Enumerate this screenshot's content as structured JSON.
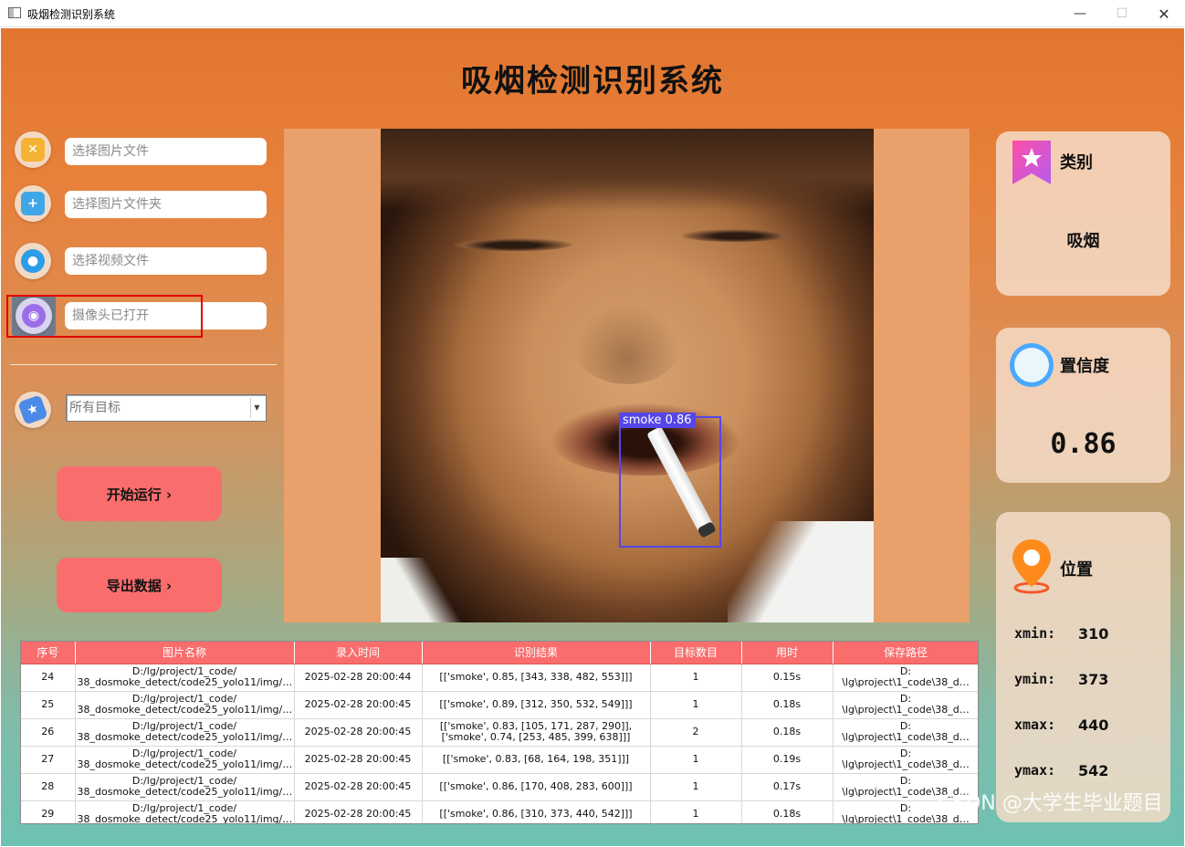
{
  "window": {
    "title": "吸烟检测识别系统"
  },
  "app": {
    "title": "吸烟检测识别系统"
  },
  "inputs": {
    "image_file": "选择图片文件",
    "image_folder": "选择图片文件夹",
    "video_file": "选择视频文件",
    "camera": "摄像头已打开"
  },
  "target_select": {
    "value": "所有目标"
  },
  "buttons": {
    "run": "开始运行 ›",
    "export": "导出数据 ›"
  },
  "detection": {
    "label": "smoke 0.86"
  },
  "result": {
    "category_label": "类别",
    "category_value": "吸烟",
    "confidence_label": "置信度",
    "confidence_value": "0.86",
    "position_label": "位置",
    "xmin_label": "xmin:",
    "xmin": "310",
    "ymin_label": "ymin:",
    "ymin": "373",
    "xmax_label": "xmax:",
    "xmax": "440",
    "ymax_label": "ymax:",
    "ymax": "542"
  },
  "table": {
    "headers": [
      "序号",
      "图片名称",
      "录入时间",
      "识别结果",
      "目标数目",
      "用时",
      "保存路径"
    ],
    "rows": [
      {
        "id": "24",
        "name": "D:/lg/project/1_code/ 38_dosmoke_detect/code25_yolo11/img/…",
        "time": "2025-02-28 20:00:44",
        "result": "[['smoke', 0.85, [343, 338, 482, 553]]]",
        "count": "1",
        "elapsed": "0.15s",
        "path": "D: \\lg\\project\\1_code\\38_d…"
      },
      {
        "id": "25",
        "name": "D:/lg/project/1_code/ 38_dosmoke_detect/code25_yolo11/img/…",
        "time": "2025-02-28 20:00:45",
        "result": "[['smoke', 0.89, [312, 350, 532, 549]]]",
        "count": "1",
        "elapsed": "0.18s",
        "path": "D: \\lg\\project\\1_code\\38_d…"
      },
      {
        "id": "26",
        "name": "D:/lg/project/1_code/ 38_dosmoke_detect/code25_yolo11/img/…",
        "time": "2025-02-28 20:00:45",
        "result": "[['smoke', 0.83, [105, 171, 287, 290]], ['smoke', 0.74, [253, 485, 399, 638]]]",
        "count": "2",
        "elapsed": "0.18s",
        "path": "D: \\lg\\project\\1_code\\38_d…"
      },
      {
        "id": "27",
        "name": "D:/lg/project/1_code/ 38_dosmoke_detect/code25_yolo11/img/…",
        "time": "2025-02-28 20:00:45",
        "result": "[['smoke', 0.83, [68, 164, 198, 351]]]",
        "count": "1",
        "elapsed": "0.19s",
        "path": "D: \\lg\\project\\1_code\\38_d…"
      },
      {
        "id": "28",
        "name": "D:/lg/project/1_code/ 38_dosmoke_detect/code25_yolo11/img/…",
        "time": "2025-02-28 20:00:45",
        "result": "[['smoke', 0.86, [170, 408, 283, 600]]]",
        "count": "1",
        "elapsed": "0.17s",
        "path": "D: \\lg\\project\\1_code\\38_d…"
      },
      {
        "id": "29",
        "name": "D:/lg/project/1_code/ 38_dosmoke_detect/code25_yolo11/img/…",
        "time": "2025-02-28 20:00:45",
        "result": "[['smoke', 0.86, [310, 373, 440, 542]]]",
        "count": "1",
        "elapsed": "0.18s",
        "path": "D: \\lg\\project\\1_code\\38_d…"
      }
    ]
  },
  "watermark": "CSDN @大学生毕业题目"
}
